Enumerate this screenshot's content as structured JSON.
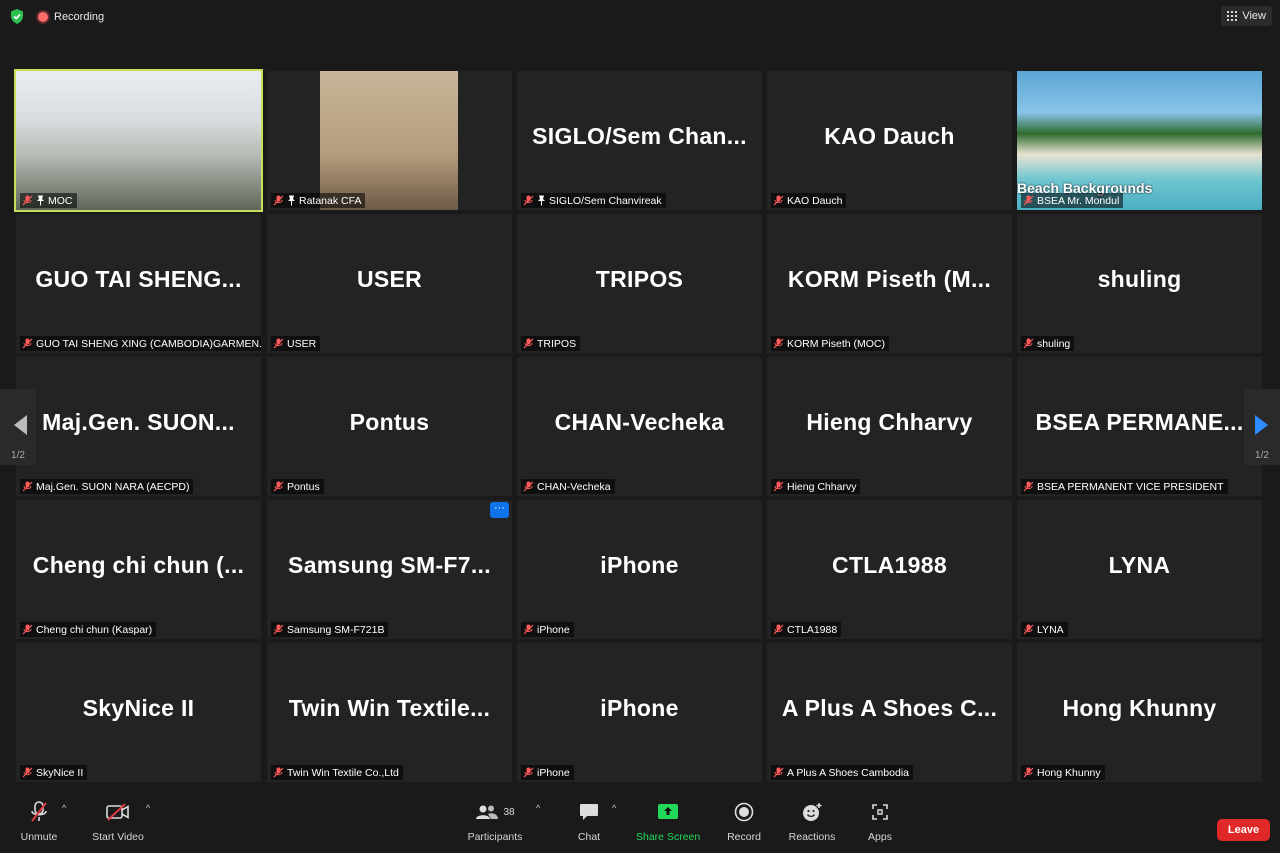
{
  "top": {
    "recording_label": "Recording",
    "view_label": "View"
  },
  "tiles": [
    {
      "name": "",
      "label": "MOC",
      "type": "video-moc",
      "pinned": true,
      "active": true
    },
    {
      "name": "",
      "label": "Ratanak CFA",
      "type": "video-rat",
      "pinned": true
    },
    {
      "name": "SIGLO/Sem Chan...",
      "label": "SIGLO/Sem Chanvireak",
      "pinned": true
    },
    {
      "name": "KAO Dauch",
      "label": "KAO Dauch"
    },
    {
      "name": "",
      "label": "BSEA Mr. Mondul",
      "type": "video-beach",
      "overlay": "Beach Backgrounds"
    },
    {
      "name": "GUO TAI SHENG...",
      "label": "GUO TAI SHENG XING (CAMBODIA)GARMEN..."
    },
    {
      "name": "USER",
      "label": "USER"
    },
    {
      "name": "TRIPOS",
      "label": "TRIPOS"
    },
    {
      "name": "KORM Piseth (M...",
      "label": "KORM Piseth (MOC)"
    },
    {
      "name": "shuling",
      "label": "shuling"
    },
    {
      "name": "Maj.Gen. SUON...",
      "label": "Maj.Gen. SUON NARA (AECPD)"
    },
    {
      "name": "Pontus",
      "label": "Pontus"
    },
    {
      "name": "CHAN-Vecheka",
      "label": "CHAN-Vecheka"
    },
    {
      "name": "Hieng Chharvy",
      "label": "Hieng Chharvy"
    },
    {
      "name": "BSEA PERMANE...",
      "label": "BSEA PERMANENT VICE PRESIDENT"
    },
    {
      "name": "Cheng chi chun (...",
      "label": "Cheng chi chun (Kaspar)"
    },
    {
      "name": "Samsung SM-F7...",
      "label": "Samsung SM-F721B",
      "more": "···"
    },
    {
      "name": "iPhone",
      "label": "iPhone"
    },
    {
      "name": "CTLA1988",
      "label": "CTLA1988"
    },
    {
      "name": "LYNA",
      "label": "LYNA"
    },
    {
      "name": "SkyNice II",
      "label": "SkyNice II"
    },
    {
      "name": "Twin Win Textile...",
      "label": "Twin Win Textile Co.,Ltd"
    },
    {
      "name": "iPhone",
      "label": "iPhone"
    },
    {
      "name": "A Plus A Shoes C...",
      "label": "A Plus A Shoes Cambodia"
    },
    {
      "name": "Hong Khunny",
      "label": "Hong Khunny"
    }
  ],
  "nav": {
    "page_left": "1/2",
    "page_right": "1/2"
  },
  "toolbar": {
    "unmute": "Unmute",
    "start_video": "Start Video",
    "participants": "Participants",
    "participants_count": "38",
    "chat": "Chat",
    "share_screen": "Share Screen",
    "record": "Record",
    "reactions": "Reactions",
    "apps": "Apps",
    "leave": "Leave"
  },
  "colors": {
    "active_border": "#c7e05a",
    "share_green": "#23d959",
    "leave_red": "#e02828",
    "accent_blue": "#2d8cff"
  }
}
